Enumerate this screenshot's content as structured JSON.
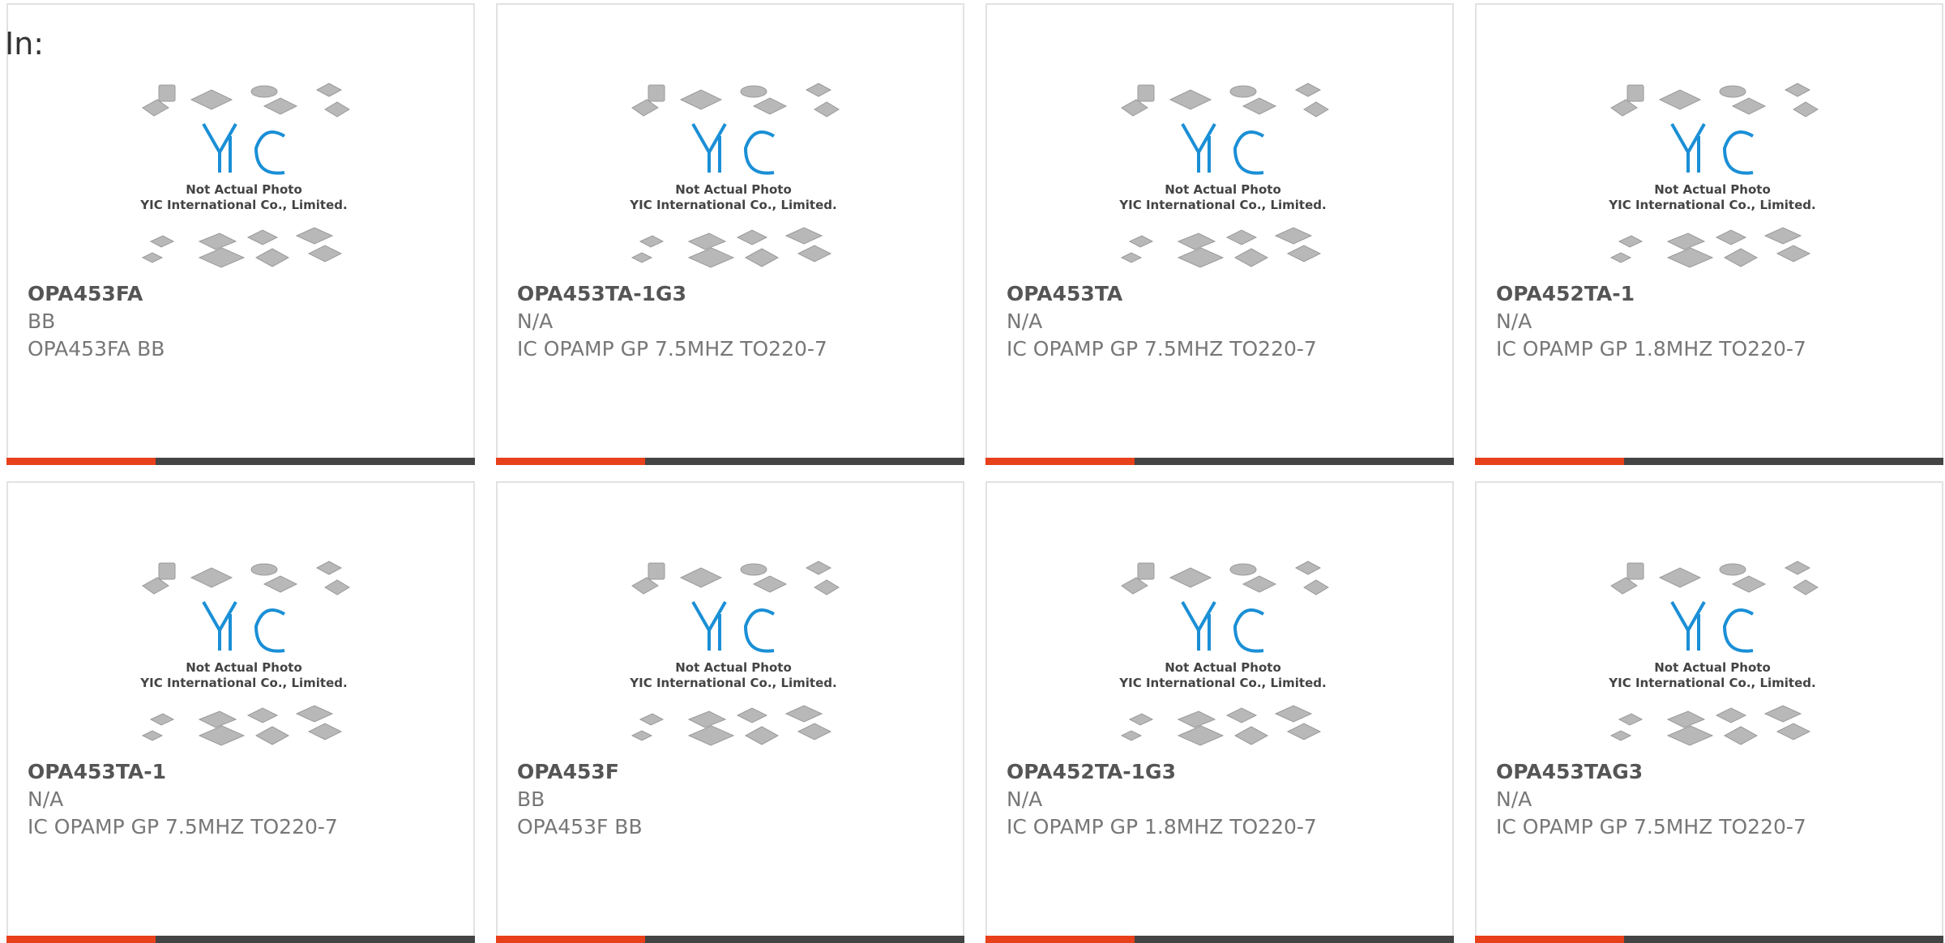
{
  "page": {
    "label": "In:"
  },
  "brand": {
    "logo_text": "YIC",
    "note_line1": "Not Actual Photo",
    "note_line2": "YIC International Co., Limited."
  },
  "colors": {
    "accent": "#e8401a",
    "bar_dark": "#444444",
    "logo_blue": "#1a8fd6"
  },
  "products": [
    {
      "part": "OPA453FA",
      "mfr": "BB",
      "desc": "OPA453FA BB"
    },
    {
      "part": "OPA453TA-1G3",
      "mfr": "N/A",
      "desc": "IC OPAMP GP 7.5MHZ TO220-7"
    },
    {
      "part": "OPA453TA",
      "mfr": "N/A",
      "desc": "IC OPAMP GP 7.5MHZ TO220-7"
    },
    {
      "part": "OPA452TA-1",
      "mfr": "N/A",
      "desc": "IC OPAMP GP 1.8MHZ TO220-7"
    },
    {
      "part": "OPA453TA-1",
      "mfr": "N/A",
      "desc": "IC OPAMP GP 7.5MHZ TO220-7"
    },
    {
      "part": "OPA453F",
      "mfr": "BB",
      "desc": "OPA453F BB"
    },
    {
      "part": "OPA452TA-1G3",
      "mfr": "N/A",
      "desc": "IC OPAMP GP 1.8MHZ TO220-7"
    },
    {
      "part": "OPA453TAG3",
      "mfr": "N/A",
      "desc": "IC OPAMP GP 7.5MHZ TO220-7"
    }
  ]
}
